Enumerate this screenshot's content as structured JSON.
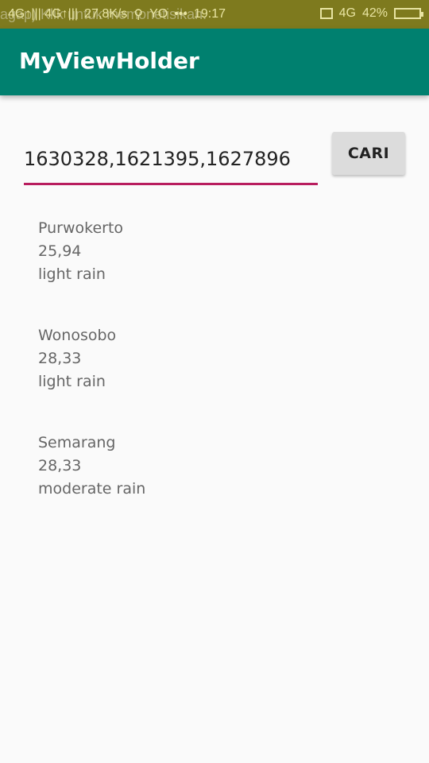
{
  "statusbar": {
    "ghost_text": "agap) Klik untuk memonetisikan.",
    "network_left": "4G↑||| 4G↑|||",
    "speed": "27,8K/s",
    "usb_icon": "usb-icon",
    "yo_icon": "YO",
    "dots": "•••",
    "time": "19:17",
    "vibrate_icon": "vibrate-icon",
    "network_right": "4G",
    "battery": "42%"
  },
  "appbar": {
    "title": "MyViewHolder"
  },
  "search": {
    "value": "1630328,1621395,1627896",
    "button_label": "CARI"
  },
  "items": [
    {
      "city": "Purwokerto",
      "temp": "25,94",
      "desc": "light rain"
    },
    {
      "city": "Wonosobo",
      "temp": "28,33",
      "desc": "light rain"
    },
    {
      "city": "Semarang",
      "temp": "28,33",
      "desc": "moderate rain"
    }
  ],
  "colors": {
    "statusbar": "#7e7a1e",
    "appbar": "#00806f",
    "accent_underline": "#b81d5e",
    "button": "#dcdcdc"
  }
}
